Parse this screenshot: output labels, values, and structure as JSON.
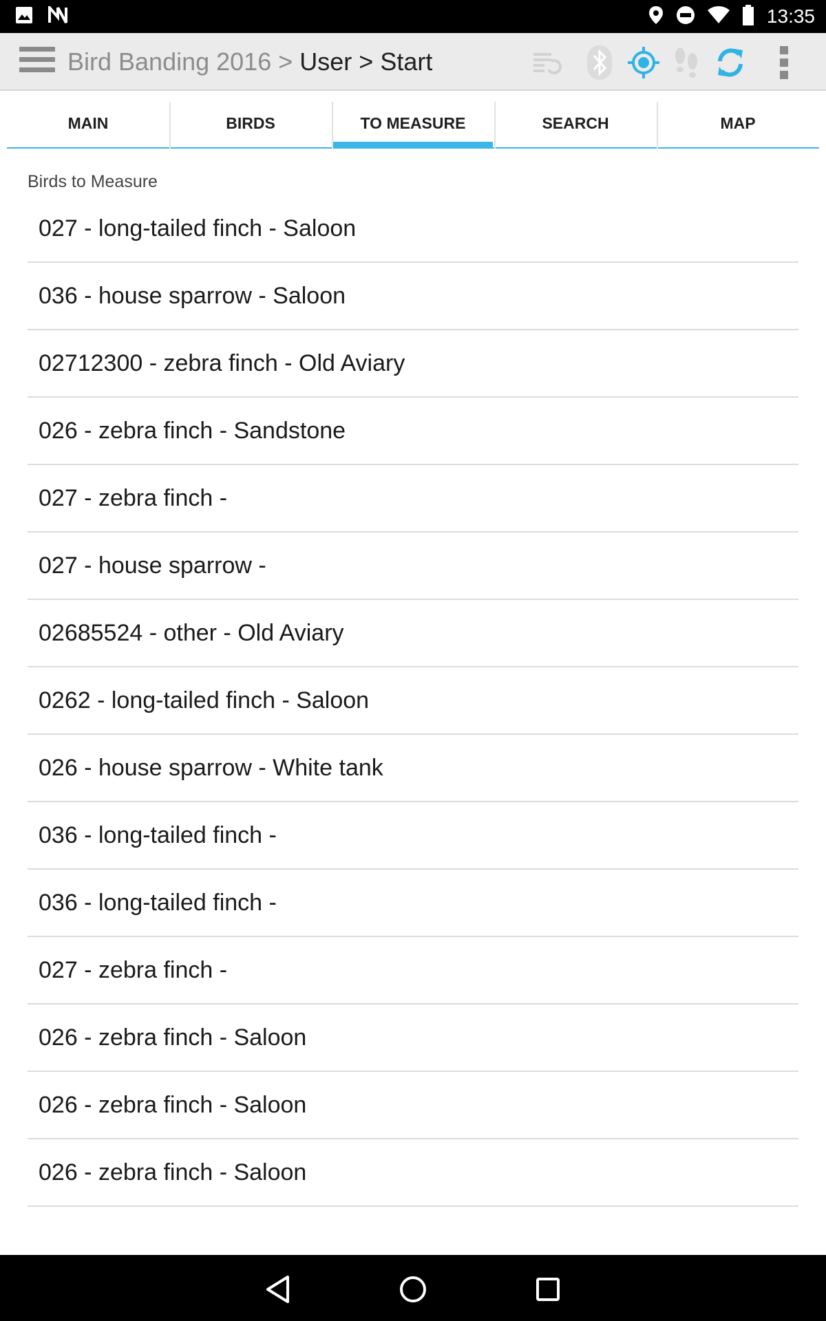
{
  "status_bar": {
    "time": "13:35",
    "left_icons": [
      "image-icon",
      "n-notification-icon"
    ],
    "right_icons": [
      "location-icon",
      "do-not-disturb-icon",
      "wifi-icon",
      "battery-icon"
    ]
  },
  "action_bar": {
    "breadcrumb": {
      "app": "Bird Banding 2016",
      "sep1": ">",
      "user": "User",
      "sep2": ">",
      "page": "Start"
    },
    "icons": [
      "sync-list-icon",
      "bluetooth-icon",
      "gps-location-icon",
      "footsteps-icon",
      "refresh-icon",
      "overflow-menu-icon"
    ],
    "accent_color": "#3bb6e6"
  },
  "tabs": [
    {
      "label": "MAIN",
      "active": false
    },
    {
      "label": "BIRDS",
      "active": false
    },
    {
      "label": "TO MEASURE",
      "active": true
    },
    {
      "label": "SEARCH",
      "active": false
    },
    {
      "label": "MAP",
      "active": false
    }
  ],
  "main": {
    "section_title": "Birds to Measure",
    "items": [
      "027 - long-tailed finch - Saloon",
      "036 - house sparrow - Saloon",
      "02712300 - zebra finch - Old Aviary",
      "026 - zebra finch - Sandstone",
      "027 - zebra finch -",
      "027 - house sparrow -",
      "02685524 - other - Old Aviary",
      "0262 - long-tailed finch - Saloon",
      "026 - house sparrow - White tank",
      "036 - long-tailed finch -",
      "036 - long-tailed finch -",
      "027 - zebra finch -",
      "026 - zebra finch - Saloon",
      "026 - zebra finch - Saloon",
      "026 - zebra finch - Saloon"
    ]
  },
  "nav_bar": {
    "icons": [
      "back-icon",
      "home-icon",
      "recents-icon"
    ]
  }
}
